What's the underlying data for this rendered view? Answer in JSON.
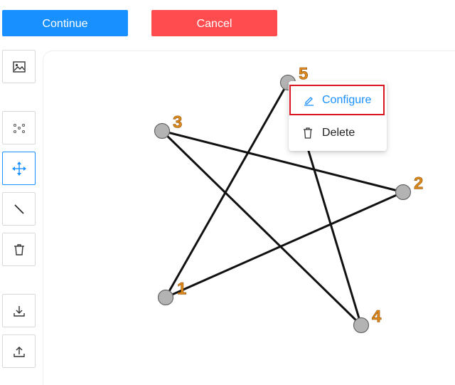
{
  "toolbar": {
    "continue_label": "Continue",
    "cancel_label": "Cancel"
  },
  "tools": [
    {
      "name": "image-tool",
      "icon": "image-icon"
    },
    {
      "name": "nodes-tool",
      "icon": "scatter-nodes-icon"
    },
    {
      "name": "move-tool",
      "icon": "move-arrows-icon",
      "active": true
    },
    {
      "name": "line-tool",
      "icon": "line-icon"
    },
    {
      "name": "delete-tool",
      "icon": "trash-icon"
    },
    {
      "name": "download-tool",
      "icon": "download-icon"
    },
    {
      "name": "upload-tool",
      "icon": "upload-icon"
    }
  ],
  "graph": {
    "nodes": [
      {
        "id": "1",
        "label": "1"
      },
      {
        "id": "2",
        "label": "2"
      },
      {
        "id": "3",
        "label": "3"
      },
      {
        "id": "4",
        "label": "4"
      },
      {
        "id": "5",
        "label": "5"
      }
    ],
    "edges": [
      [
        "5",
        "1"
      ],
      [
        "1",
        "2"
      ],
      [
        "2",
        "3"
      ],
      [
        "3",
        "4"
      ],
      [
        "4",
        "5"
      ]
    ],
    "colors": {
      "node_fill": "#b3b3b3",
      "node_stroke": "#666666",
      "edge": "#111111",
      "label": "#e08a1e"
    }
  },
  "context_menu": {
    "configure_label": "Configure",
    "delete_label": "Delete",
    "highlight_color": "#d9161f"
  }
}
